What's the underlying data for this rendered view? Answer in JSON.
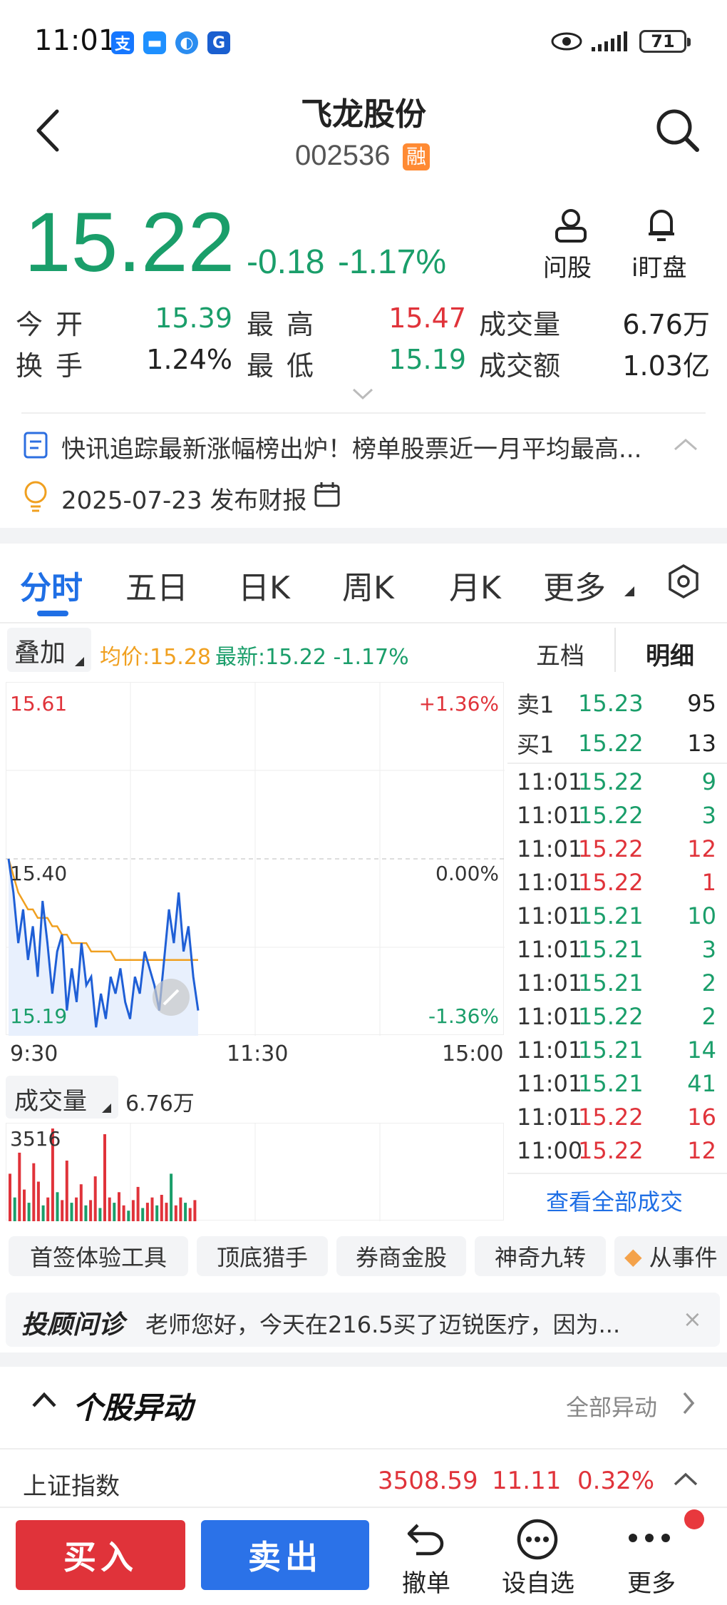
{
  "status_bar": {
    "time": "11:01",
    "battery": "71"
  },
  "header": {
    "name": "飞龙股份",
    "code": "002536",
    "margin_badge": "融"
  },
  "quote": {
    "price": "15.22",
    "change": "-0.18",
    "change_pct": "-1.17%",
    "ask_label": "问股",
    "watch_label": "i盯盘"
  },
  "stats": {
    "open_label": "今开",
    "open": "15.39",
    "high_label": "最高",
    "high": "15.47",
    "volume_label": "成交量",
    "volume": "6.76万",
    "turnover_label": "换手",
    "turnover": "1.24%",
    "low_label": "最低",
    "low": "15.19",
    "amount_label": "成交额",
    "amount": "1.03亿"
  },
  "news": {
    "headline": "快讯追踪最新涨幅榜出炉！榜单股票近一月平均最高...",
    "report": "2025-07-23 发布财报"
  },
  "tabs": [
    "分时",
    "五日",
    "日K",
    "周K",
    "月K",
    "更多"
  ],
  "chart_bar": {
    "overlay": "叠加",
    "avg": "均价:15.28",
    "latest": "最新:15.22 -1.17%",
    "five_level": "五档",
    "detail": "明细"
  },
  "chart_data": {
    "type": "line",
    "y_max_label": "15.61",
    "y_mid_label": "15.40",
    "y_min_label": "15.19",
    "pct_top": "+1.36%",
    "pct_mid": "0.00%",
    "pct_bottom": "-1.36%",
    "x_labels": [
      "9:30",
      "11:30",
      "15:00"
    ],
    "ylim": [
      15.19,
      15.61
    ],
    "price": [
      15.4,
      15.36,
      15.3,
      15.34,
      15.28,
      15.32,
      15.26,
      15.35,
      15.3,
      15.24,
      15.29,
      15.31,
      15.22,
      15.27,
      15.23,
      15.3,
      15.25,
      15.26,
      15.2,
      15.24,
      15.21,
      15.26,
      15.24,
      15.27,
      15.23,
      15.21,
      15.26,
      15.24,
      15.29,
      15.27,
      15.25,
      15.22,
      15.28,
      15.34,
      15.3,
      15.36,
      15.29,
      15.32,
      15.26,
      15.22
    ],
    "avg": [
      15.4,
      15.38,
      15.36,
      15.35,
      15.34,
      15.34,
      15.33,
      15.33,
      15.33,
      15.32,
      15.32,
      15.31,
      15.31,
      15.3,
      15.3,
      15.3,
      15.3,
      15.29,
      15.29,
      15.29,
      15.29,
      15.29,
      15.28,
      15.28,
      15.28,
      15.28,
      15.28,
      15.28,
      15.28,
      15.28,
      15.28,
      15.28,
      15.28,
      15.28,
      15.28,
      15.28,
      15.28,
      15.28,
      15.28,
      15.28
    ]
  },
  "volume_bar": {
    "label": "成交量",
    "value": "6.76万",
    "max": "3516"
  },
  "volume_data": [
    1800,
    900,
    2600,
    1200,
    700,
    2200,
    1500,
    600,
    900,
    3516,
    1100,
    800,
    2300,
    700,
    900,
    1400,
    600,
    800,
    1700,
    500,
    3300,
    900,
    700,
    1100,
    600,
    400,
    800,
    1300,
    500,
    700,
    900,
    600,
    1000,
    700,
    1800,
    600,
    900,
    700,
    500,
    800
  ],
  "orderbook": {
    "sell_label": "卖1",
    "sell_price": "15.23",
    "sell_vol": "95",
    "buy_label": "买1",
    "buy_price": "15.22",
    "buy_vol": "13"
  },
  "trades": [
    {
      "time": "11:01",
      "price": "15.22",
      "vol": "9",
      "dir": "g"
    },
    {
      "time": "11:01",
      "price": "15.22",
      "vol": "3",
      "dir": "g"
    },
    {
      "time": "11:01",
      "price": "15.22",
      "vol": "12",
      "dir": "r"
    },
    {
      "time": "11:01",
      "price": "15.22",
      "vol": "1",
      "dir": "r"
    },
    {
      "time": "11:01",
      "price": "15.21",
      "vol": "10",
      "dir": "g"
    },
    {
      "time": "11:01",
      "price": "15.21",
      "vol": "3",
      "dir": "g"
    },
    {
      "time": "11:01",
      "price": "15.21",
      "vol": "2",
      "dir": "g"
    },
    {
      "time": "11:01",
      "price": "15.22",
      "vol": "2",
      "dir": "g"
    },
    {
      "time": "11:01",
      "price": "15.21",
      "vol": "14",
      "dir": "g"
    },
    {
      "time": "11:01",
      "price": "15.21",
      "vol": "41",
      "dir": "g"
    },
    {
      "time": "11:01",
      "price": "15.22",
      "vol": "16",
      "dir": "r"
    },
    {
      "time": "11:00",
      "price": "15.22",
      "vol": "12",
      "dir": "r"
    }
  ],
  "view_all": "查看全部成交",
  "chips": [
    "首签体验工具",
    "顶底猎手",
    "券商金股",
    "神奇九转",
    "从事件"
  ],
  "advisor": {
    "logo": "投顾问诊",
    "text": "老师您好，今天在216.5买了迈锐医疗，因为..."
  },
  "anomaly": {
    "title": "个股异动",
    "all": "全部异动"
  },
  "index": {
    "name": "上证指数",
    "value": "3508.59",
    "change": "11.11",
    "pct": "0.32%"
  },
  "bottom": {
    "buy": "买入",
    "sell": "卖出",
    "cancel": "撤单",
    "watch": "设自选",
    "more": "更多"
  },
  "colors": {
    "up": "#e0333a",
    "down": "#1a9e6a",
    "accent": "#1f6fe5",
    "avg_line": "#f0a020"
  }
}
